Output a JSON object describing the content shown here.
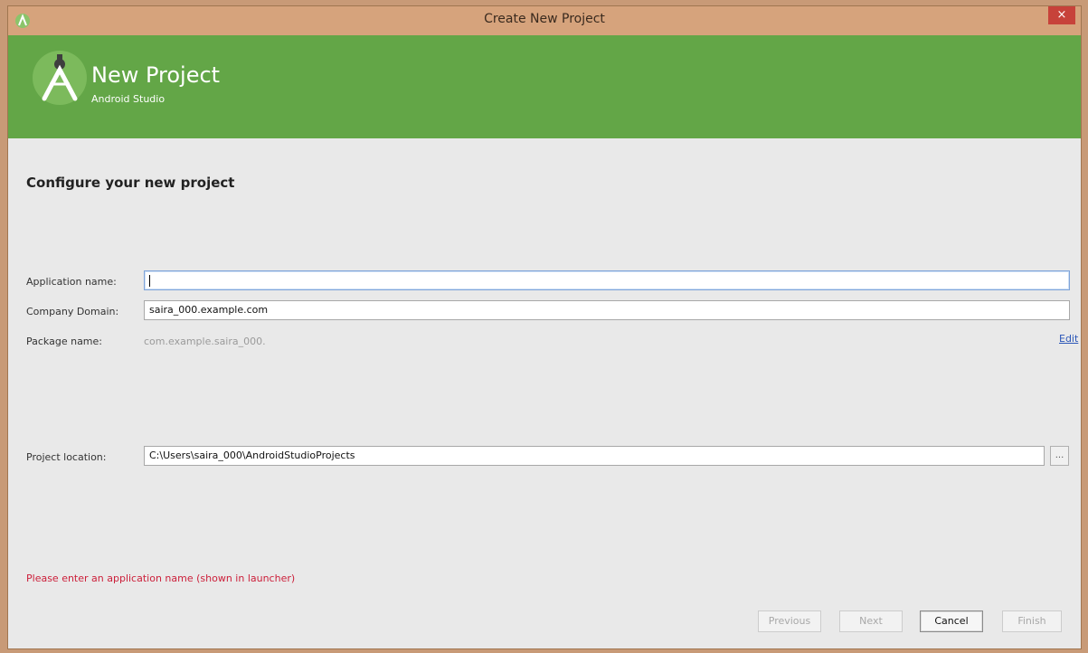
{
  "window": {
    "title": "Create New Project",
    "close_label": "×"
  },
  "banner": {
    "title": "New Project",
    "subtitle": "Android Studio"
  },
  "form": {
    "section_title": "Configure your new project",
    "app_name": {
      "label": "Application name:",
      "value": ""
    },
    "company_domain": {
      "label": "Company Domain:",
      "value": "saira_000.example.com"
    },
    "package_name": {
      "label": "Package name:",
      "value": "com.example.saira_000.",
      "edit_label": "Edit"
    },
    "project_location": {
      "label": "Project location:",
      "value": "C:\\Users\\saira_000\\AndroidStudioProjects",
      "browse_label": "..."
    }
  },
  "error_message": "Please enter an application name (shown in launcher)",
  "buttons": {
    "previous": "Previous",
    "next": "Next",
    "cancel": "Cancel",
    "finish": "Finish"
  },
  "colors": {
    "banner_green": "#63a647",
    "error_red": "#cc1f3a",
    "link_blue": "#2a56b8"
  }
}
